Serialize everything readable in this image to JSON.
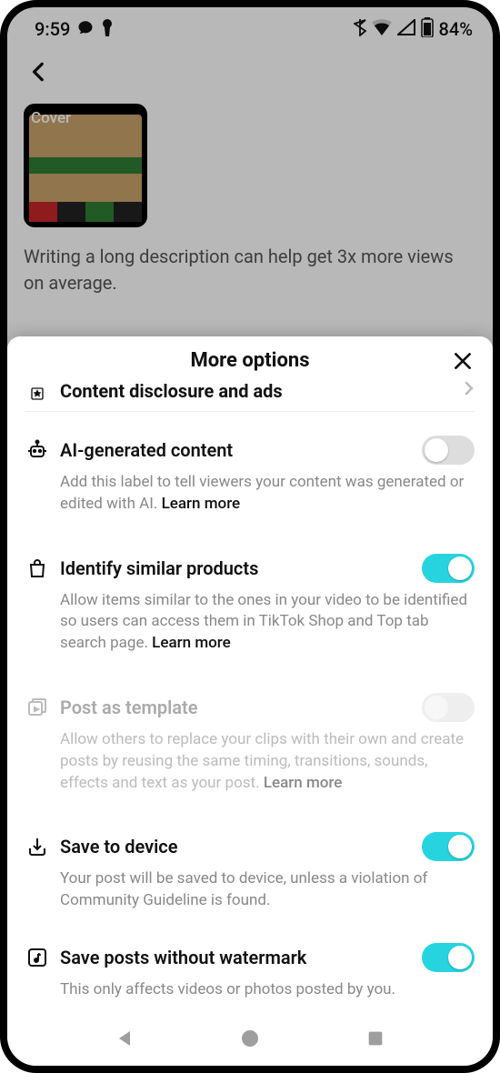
{
  "status": {
    "time": "9:59",
    "battery": "84%"
  },
  "background": {
    "cover_label": "Cover",
    "hint": "Writing a long description can help get 3x more views on average."
  },
  "sheet": {
    "title": "More options",
    "partial_row": {
      "title": "Content disclosure and ads"
    },
    "rows": [
      {
        "key": "ai",
        "title": "AI-generated content",
        "desc": "Add this label to tell viewers your content was generated or edited with AI. ",
        "learn_more": "Learn more",
        "toggle": false,
        "disabled": false
      },
      {
        "key": "similar",
        "title": "Identify similar products",
        "desc": "Allow items similar to the ones in your video to be identified so users can access them in TikTok Shop and Top tab search page. ",
        "learn_more": "Learn more",
        "toggle": true,
        "disabled": false
      },
      {
        "key": "template",
        "title": "Post as template",
        "desc": "Allow others to replace your clips with their own and create posts by reusing the same timing, transitions, sounds, effects and text as your post. ",
        "learn_more": "Learn more",
        "toggle": false,
        "disabled": true
      },
      {
        "key": "save",
        "title": "Save to device",
        "desc": "Your post will be saved to device, unless a violation of Community Guideline is found.",
        "learn_more": "",
        "toggle": true,
        "disabled": false
      },
      {
        "key": "watermark",
        "title": "Save posts without watermark",
        "desc": "This only affects videos or photos posted by you.",
        "learn_more": "",
        "toggle": true,
        "disabled": false
      }
    ]
  }
}
